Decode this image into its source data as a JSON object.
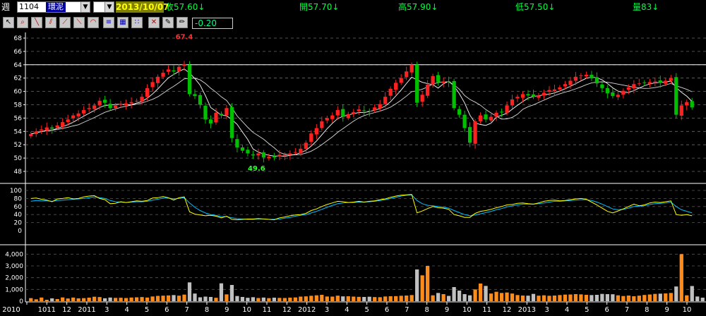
{
  "header": {
    "period_label": "週",
    "stock_code": "1104",
    "stock_name": "環泥",
    "small_select": "",
    "date": "2013/10/07",
    "quotes": [
      {
        "label": "收57.60↓"
      },
      {
        "label": "開57.70↓"
      },
      {
        "label": "高57.90↓"
      },
      {
        "label": "低57.50↓"
      },
      {
        "label": "量83↓"
      }
    ]
  },
  "toolbar": {
    "buttons": [
      "pointer-tool",
      "zoom-tool",
      "line-tool",
      "parallel-tool",
      "fan-tool",
      "fan-tool-2",
      "arc-tool",
      "fibonacci-tool",
      "grid-tool",
      "cycle-tool",
      "magnet-tool",
      "delete-tool",
      "brush-tool",
      "pencil-tool"
    ],
    "value": "-0.20"
  },
  "colors": {
    "up": "#ff2020",
    "down": "#00c000",
    "ma_short": "#ffffff",
    "ma_long": "#ffffff",
    "k_line": "#ffff00",
    "d_line": "#00c0ff",
    "vol_up": "#ff8c1a",
    "vol_down": "#c0c0c0"
  },
  "chart_data": [
    {
      "type": "candlestick",
      "ylim": [
        48,
        68
      ],
      "yticks": [
        "68",
        "66",
        "64",
        "62",
        "60",
        "58",
        "56",
        "54",
        "52",
        "50",
        "48"
      ],
      "horizontal_line": 64,
      "annotations": [
        {
          "text": "67.4",
          "color": "red"
        },
        {
          "text": "49.6",
          "color": "green"
        }
      ],
      "x_labels": [
        "2010",
        "1011",
        "12",
        "2011",
        "3",
        "4",
        "5",
        "6",
        "7",
        "8",
        "9",
        "10",
        "11",
        "12",
        "2012",
        "3",
        "4",
        "5",
        "6",
        "7",
        "8",
        "9",
        "10",
        "11",
        "12",
        "2013",
        "3",
        "4",
        "5",
        "6",
        "7",
        "8",
        "9",
        "10"
      ],
      "closes": [
        53.6,
        54.0,
        54.3,
        54.6,
        54.4,
        54.9,
        55.4,
        55.8,
        56.4,
        56.7,
        57.2,
        57.5,
        57.9,
        58.6,
        58.3,
        57.5,
        57.9,
        58.1,
        58.2,
        58.4,
        58.6,
        59.2,
        60.5,
        61.4,
        62.2,
        62.8,
        63.3,
        63.0,
        63.7,
        64.1,
        59.6,
        59.3,
        58.0,
        55.8,
        55.2,
        56.8,
        56.4,
        57.5,
        53.0,
        51.6,
        51.1,
        50.7,
        50.4,
        50.7,
        50.1,
        50.2,
        50.1,
        50.5,
        50.5,
        50.7,
        50.9,
        51.4,
        52.3,
        53.7,
        54.5,
        55.5,
        56.0,
        56.4,
        57.2,
        56.2,
        56.6,
        56.9,
        57.3,
        57.1,
        57.0,
        57.6,
        58.1,
        59.2,
        60.4,
        61.3,
        62.0,
        63.0,
        64.0,
        58.3,
        59.5,
        61.0,
        62.3,
        61.4,
        61.5,
        61.4,
        57.5,
        56.5,
        54.5,
        52.3,
        55.5,
        56.4,
        55.8,
        56.2,
        56.8,
        56.9,
        57.9,
        58.8,
        59.2,
        59.6,
        59.4,
        59.2,
        59.4,
        59.8,
        60.2,
        60.3,
        60.6,
        61.1,
        61.6,
        62.2,
        62.4,
        62.5,
        62.0,
        61.2,
        60.5,
        59.7,
        59.3,
        59.5,
        60.1,
        60.6,
        61.1,
        61.2,
        61.3,
        61.4,
        61.5,
        61.3,
        61.6,
        62.0,
        56.5,
        57.9,
        58.4,
        57.6
      ],
      "kd": {
        "k": [
          80,
          81,
          78,
          76,
          72,
          79,
          80,
          82,
          79,
          80,
          84,
          86,
          87,
          80,
          77,
          67,
          68,
          72,
          70,
          72,
          74,
          73,
          75,
          81,
          82,
          85,
          82,
          76,
          82,
          84,
          47,
          41,
          39,
          37,
          38,
          36,
          32,
          36,
          28,
          27,
          28,
          29,
          29,
          30,
          29,
          28,
          27,
          32,
          34,
          37,
          39,
          40,
          43,
          50,
          54,
          60,
          65,
          69,
          73,
          72,
          70,
          71,
          73,
          71,
          73,
          74,
          77,
          79,
          83,
          86,
          88,
          89,
          90,
          44,
          49,
          55,
          60,
          57,
          56,
          53,
          40,
          37,
          33,
          33,
          43,
          48,
          50,
          53,
          57,
          60,
          64,
          65,
          68,
          69,
          67,
          66,
          69,
          73,
          75,
          76,
          74,
          75,
          77,
          79,
          80,
          78,
          71,
          64,
          56,
          48,
          44,
          49,
          54,
          60,
          66,
          62,
          64,
          69,
          71,
          70,
          72,
          74,
          40,
          38,
          40,
          37
        ],
        "d": [
          73,
          75,
          74,
          74,
          73,
          75,
          76,
          77,
          78,
          79,
          80,
          82,
          84,
          82,
          80,
          75,
          72,
          71,
          70,
          71,
          72,
          72,
          73,
          76,
          78,
          81,
          81,
          79,
          80,
          82,
          69,
          58,
          50,
          44,
          40,
          38,
          35,
          35,
          32,
          30,
          29,
          28,
          28,
          29,
          29,
          28,
          28,
          29,
          31,
          33,
          36,
          38,
          40,
          44,
          48,
          53,
          58,
          63,
          67,
          69,
          70,
          70,
          71,
          71,
          72,
          73,
          75,
          77,
          80,
          83,
          86,
          88,
          89,
          75,
          67,
          63,
          62,
          60,
          58,
          56,
          50,
          45,
          40,
          37,
          39,
          42,
          45,
          48,
          52,
          55,
          59,
          62,
          64,
          66,
          66,
          66,
          67,
          69,
          71,
          73,
          73,
          74,
          75,
          76,
          77,
          77,
          75,
          71,
          66,
          60,
          54,
          52,
          53,
          56,
          60,
          61,
          62,
          65,
          67,
          68,
          69,
          71,
          60,
          52,
          48,
          44
        ]
      },
      "volume": {
        "values": [
          260,
          160,
          310,
          120,
          240,
          180,
          320,
          230,
          310,
          240,
          260,
          300,
          380,
          350,
          250,
          310,
          280,
          290,
          270,
          310,
          330,
          350,
          310,
          400,
          450,
          470,
          490,
          520,
          470,
          560,
          1600,
          650,
          330,
          390,
          360,
          290,
          1520,
          580,
          1380,
          440,
          360,
          290,
          340,
          270,
          310,
          260,
          300,
          280,
          270,
          300,
          320,
          390,
          410,
          460,
          500,
          540,
          400,
          390,
          470,
          410,
          420,
          390,
          370,
          360,
          380,
          350,
          340,
          400,
          420,
          430,
          460,
          480,
          520,
          2700,
          2200,
          3000,
          500,
          700,
          600,
          450,
          1200,
          900,
          600,
          500,
          1000,
          1500,
          1300,
          650,
          800,
          700,
          740,
          650,
          520,
          480,
          470,
          620,
          470,
          500,
          460,
          480,
          520,
          560,
          570,
          600,
          580,
          540,
          520,
          540,
          620,
          600,
          590,
          500,
          440,
          480,
          420,
          470,
          530,
          570,
          620,
          640,
          660,
          700,
          1250,
          4000,
          500,
          1290,
          400,
          300
        ],
        "ylim": [
          0,
          4200
        ],
        "yticks": [
          "4,000",
          "3,000",
          "2,000",
          "1,000",
          "0"
        ]
      }
    }
  ]
}
